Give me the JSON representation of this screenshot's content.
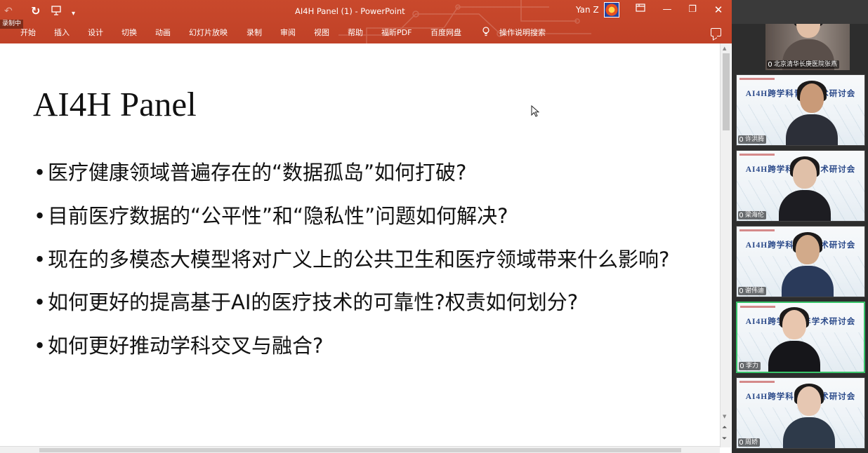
{
  "quick_access": {
    "undo_icon": "undo-icon",
    "redo_icon": "redo-icon",
    "present_icon": "present-icon",
    "customize_icon": "dropdown-icon"
  },
  "recording_badge": "录制中",
  "window": {
    "title": "AI4H Panel (1)  -  PowerPoint",
    "user": "Yan Z",
    "ribbon_color": "#c4462a"
  },
  "ribbon_tabs": [
    "开始",
    "插入",
    "设计",
    "切换",
    "动画",
    "幻灯片放映",
    "录制",
    "审阅",
    "视图",
    "帮助",
    "福昕PDF",
    "百度网盘",
    "操作说明搜索"
  ],
  "slide": {
    "title": "AI4H Panel",
    "bullets": [
      "医疗健康领域普遍存在的“数据孤岛”如何打破?",
      "目前医疗数据的“公平性”和“隐私性”问题如何解决?",
      "现在的多模态大模型将对广义上的公共卫生和医疗领域带来什么影响?",
      "如何更好的提高基于AI的医疗技术的可靠性?权责如何划分?",
      "如何更好推动学科交叉与融合?"
    ]
  },
  "participants": [
    {
      "name": "北京清华长庚医院张燕",
      "speaking": false
    },
    {
      "name": "许洪腾",
      "speaking": false
    },
    {
      "name": "梁海伦",
      "speaking": false
    },
    {
      "name": "谢伟迪",
      "speaking": false
    },
    {
      "name": "李力",
      "speaking": true
    },
    {
      "name": "周娇",
      "speaking": false
    }
  ],
  "tile_banner": "AI4H跨学科青年学术研讨会",
  "colors": {
    "speaking_border": "#39c46a",
    "banner_text": "#2b4a8a"
  }
}
